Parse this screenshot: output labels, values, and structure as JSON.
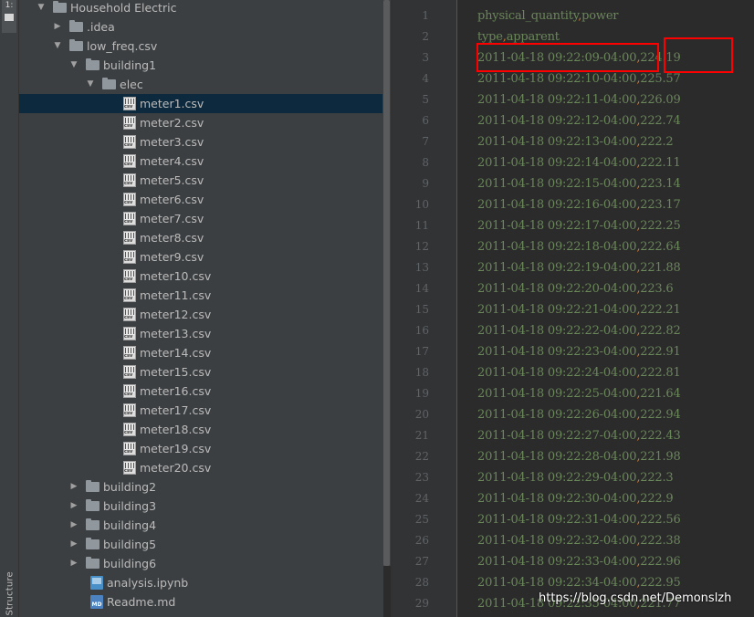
{
  "left_stripe": {
    "tab_label": "1:",
    "structure_label": "Structure"
  },
  "project_tree": {
    "rows": [
      {
        "label": "Household Electric",
        "kind": "folder",
        "depth": 0,
        "expanded": true
      },
      {
        "label": ".idea",
        "kind": "folder",
        "depth": 1,
        "expanded": false
      },
      {
        "label": "low_freq.csv",
        "kind": "folder",
        "depth": 1,
        "expanded": true
      },
      {
        "label": "building1",
        "kind": "folder",
        "depth": 2,
        "expanded": true
      },
      {
        "label": "elec",
        "kind": "folder",
        "depth": 3,
        "expanded": true
      },
      {
        "label": "meter1.csv",
        "kind": "csv",
        "depth": 4,
        "selected": true
      },
      {
        "label": "meter2.csv",
        "kind": "csv",
        "depth": 4
      },
      {
        "label": "meter3.csv",
        "kind": "csv",
        "depth": 4
      },
      {
        "label": "meter4.csv",
        "kind": "csv",
        "depth": 4
      },
      {
        "label": "meter5.csv",
        "kind": "csv",
        "depth": 4
      },
      {
        "label": "meter6.csv",
        "kind": "csv",
        "depth": 4
      },
      {
        "label": "meter7.csv",
        "kind": "csv",
        "depth": 4
      },
      {
        "label": "meter8.csv",
        "kind": "csv",
        "depth": 4
      },
      {
        "label": "meter9.csv",
        "kind": "csv",
        "depth": 4
      },
      {
        "label": "meter10.csv",
        "kind": "csv",
        "depth": 4
      },
      {
        "label": "meter11.csv",
        "kind": "csv",
        "depth": 4
      },
      {
        "label": "meter12.csv",
        "kind": "csv",
        "depth": 4
      },
      {
        "label": "meter13.csv",
        "kind": "csv",
        "depth": 4
      },
      {
        "label": "meter14.csv",
        "kind": "csv",
        "depth": 4
      },
      {
        "label": "meter15.csv",
        "kind": "csv",
        "depth": 4
      },
      {
        "label": "meter16.csv",
        "kind": "csv",
        "depth": 4
      },
      {
        "label": "meter17.csv",
        "kind": "csv",
        "depth": 4
      },
      {
        "label": "meter18.csv",
        "kind": "csv",
        "depth": 4
      },
      {
        "label": "meter19.csv",
        "kind": "csv",
        "depth": 4
      },
      {
        "label": "meter20.csv",
        "kind": "csv",
        "depth": 4
      },
      {
        "label": "building2",
        "kind": "folder",
        "depth": 2,
        "expanded": false
      },
      {
        "label": "building3",
        "kind": "folder",
        "depth": 2,
        "expanded": false
      },
      {
        "label": "building4",
        "kind": "folder",
        "depth": 2,
        "expanded": false
      },
      {
        "label": "building5",
        "kind": "folder",
        "depth": 2,
        "expanded": false
      },
      {
        "label": "building6",
        "kind": "folder",
        "depth": 2,
        "expanded": false
      },
      {
        "label": "analysis.ipynb",
        "kind": "notebook",
        "depth": 2
      },
      {
        "label": "Readme.md",
        "kind": "markdown",
        "depth": 2
      }
    ],
    "csv_icon_text": "csv",
    "md_icon_text": "MD"
  },
  "editor": {
    "lines": [
      {
        "num": "1",
        "parts": [
          "physical_quantity",
          ",",
          "power"
        ]
      },
      {
        "num": "2",
        "parts": [
          "type",
          ",",
          "apparent"
        ]
      },
      {
        "num": "3",
        "parts": [
          "2011-04-18 09:22:09-04:00",
          ",",
          "224.19"
        ]
      },
      {
        "num": "4",
        "parts": [
          "2011-04-18 09:22:10-04:00",
          ",",
          "225.57"
        ]
      },
      {
        "num": "5",
        "parts": [
          "2011-04-18 09:22:11-04:00",
          ",",
          "226.09"
        ]
      },
      {
        "num": "6",
        "parts": [
          "2011-04-18 09:22:12-04:00",
          ",",
          "222.74"
        ]
      },
      {
        "num": "7",
        "parts": [
          "2011-04-18 09:22:13-04:00",
          ",",
          "222.2"
        ]
      },
      {
        "num": "8",
        "parts": [
          "2011-04-18 09:22:14-04:00",
          ",",
          "222.11"
        ]
      },
      {
        "num": "9",
        "parts": [
          "2011-04-18 09:22:15-04:00",
          ",",
          "223.14"
        ]
      },
      {
        "num": "10",
        "parts": [
          "2011-04-18 09:22:16-04:00",
          ",",
          "223.17"
        ]
      },
      {
        "num": "11",
        "parts": [
          "2011-04-18 09:22:17-04:00",
          ",",
          "222.25"
        ]
      },
      {
        "num": "12",
        "parts": [
          "2011-04-18 09:22:18-04:00",
          ",",
          "222.64"
        ]
      },
      {
        "num": "13",
        "parts": [
          "2011-04-18 09:22:19-04:00",
          ",",
          "221.88"
        ]
      },
      {
        "num": "14",
        "parts": [
          "2011-04-18 09:22:20-04:00",
          ",",
          "223.6"
        ]
      },
      {
        "num": "15",
        "parts": [
          "2011-04-18 09:22:21-04:00",
          ",",
          "222.21"
        ]
      },
      {
        "num": "16",
        "parts": [
          "2011-04-18 09:22:22-04:00",
          ",",
          "222.82"
        ]
      },
      {
        "num": "17",
        "parts": [
          "2011-04-18 09:22:23-04:00",
          ",",
          "222.91"
        ]
      },
      {
        "num": "18",
        "parts": [
          "2011-04-18 09:22:24-04:00",
          ",",
          "222.81"
        ]
      },
      {
        "num": "19",
        "parts": [
          "2011-04-18 09:22:25-04:00",
          ",",
          "221.64"
        ]
      },
      {
        "num": "20",
        "parts": [
          "2011-04-18 09:22:26-04:00",
          ",",
          "222.94"
        ]
      },
      {
        "num": "21",
        "parts": [
          "2011-04-18 09:22:27-04:00",
          ",",
          "222.43"
        ]
      },
      {
        "num": "22",
        "parts": [
          "2011-04-18 09:22:28-04:00",
          ",",
          "221.98"
        ]
      },
      {
        "num": "23",
        "parts": [
          "2011-04-18 09:22:29-04:00",
          ",",
          "222.3"
        ]
      },
      {
        "num": "24",
        "parts": [
          "2011-04-18 09:22:30-04:00",
          ",",
          "222.9"
        ]
      },
      {
        "num": "25",
        "parts": [
          "2011-04-18 09:22:31-04:00",
          ",",
          "222.56"
        ]
      },
      {
        "num": "26",
        "parts": [
          "2011-04-18 09:22:32-04:00",
          ",",
          "222.38"
        ]
      },
      {
        "num": "27",
        "parts": [
          "2011-04-18 09:22:33-04:00",
          ",",
          "222.96"
        ]
      },
      {
        "num": "28",
        "parts": [
          "2011-04-18 09:22:34-04:00",
          ",",
          "222.95"
        ]
      },
      {
        "num": "29",
        "parts": [
          "2011-04-18 09:22:35-04:00",
          ",",
          "221.77"
        ]
      }
    ]
  },
  "watermark": "https://blog.csdn.net/Demonslzh",
  "colors": {
    "data_text": "#6a8759",
    "comma": "#cc7832",
    "highlight_box": "#ff0000",
    "selection": "#0d293e"
  }
}
